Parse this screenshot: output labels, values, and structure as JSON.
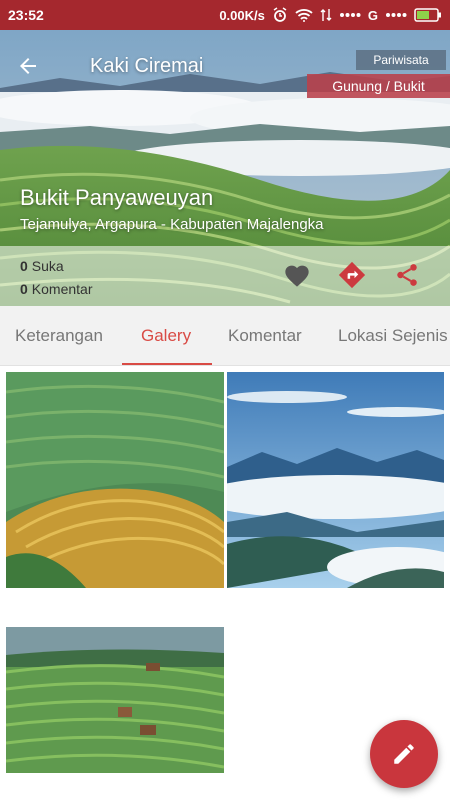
{
  "status_bar": {
    "time": "23:52",
    "net_speed": "0.00K/s",
    "carrier": "G"
  },
  "toolbar": {
    "title": "Kaki Ciremai",
    "back_icon": "arrow-back-icon"
  },
  "place": {
    "category": "Pariwisata",
    "subcategory": "Gunung / Bukit",
    "name": "Bukit Panyaweuyan",
    "address": "Tejamulya, Argapura - Kabupaten Majalengka",
    "likes_count": "0",
    "likes_label": "Suka",
    "comments_count": "0",
    "comments_label": "Komentar"
  },
  "tabs": [
    {
      "label": "Keterangan"
    },
    {
      "label": "Galery"
    },
    {
      "label": "Komentar"
    },
    {
      "label": "Lokasi Sejenis"
    }
  ],
  "active_tab": "Galery",
  "colors": {
    "status_bar": "#a5282e",
    "accent": "#d94b45",
    "fab": "#c9363d"
  },
  "gallery": [
    "terraced-hills-photo",
    "sea-of-clouds-photo",
    "green-terraces-photo"
  ],
  "fab_icon": "pencil-icon"
}
